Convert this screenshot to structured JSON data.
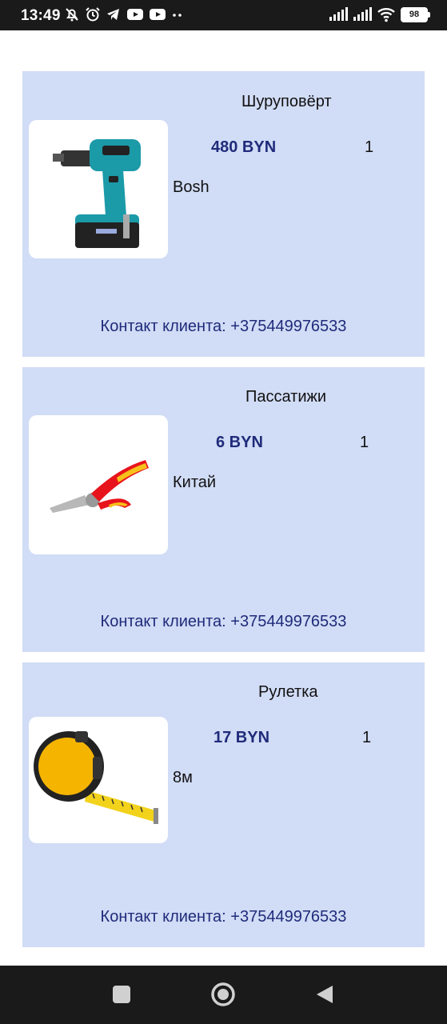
{
  "status_bar": {
    "time": "13:49",
    "battery": "98",
    "icons": [
      "mute-bell-icon",
      "alarm-icon",
      "telegram-icon",
      "youtube-icon",
      "youtube-icon",
      "more-dots-icon",
      "signal-icon",
      "signal-icon",
      "wifi-icon",
      "battery-icon"
    ]
  },
  "products": [
    {
      "name": "Шуруповёрт",
      "price": "480 BYN",
      "quantity": "1",
      "description": "Bosh",
      "contact": "Контакт клиента: +375449976533",
      "image": "drill-image"
    },
    {
      "name": "Пассатижи",
      "price": "6 BYN",
      "quantity": "1",
      "description": "Китай",
      "contact": "Контакт клиента: +375449976533",
      "image": "pliers-image"
    },
    {
      "name": "Рулетка",
      "price": "17 BYN",
      "quantity": "1",
      "description": "8м",
      "contact": "Контакт клиента: +375449976533",
      "image": "tape-measure-image"
    }
  ],
  "colors": {
    "card_bg": "#d1dcf6",
    "accent_text": "#1f2b7a",
    "bars": "#1a1a1a"
  },
  "nav_bar": {
    "buttons": [
      "recents-button",
      "home-button",
      "back-button"
    ]
  }
}
